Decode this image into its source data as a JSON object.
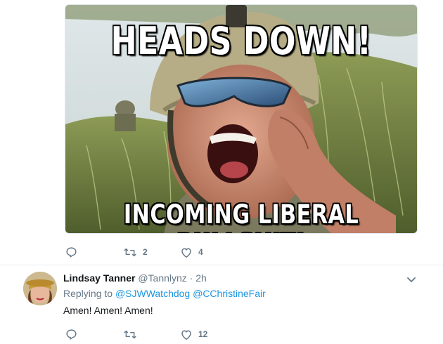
{
  "meme": {
    "top_text": "HEADS DOWN!",
    "bottom_text": "INCOMING LIBERAL BULLSHIT!"
  },
  "first_tweet_actions": {
    "reply_count": "",
    "retweet_count": "2",
    "like_count": "4"
  },
  "reply": {
    "display_name": "Lindsay Tanner",
    "handle": "@Tannlynz",
    "separator": "·",
    "time": "2h",
    "replying_prefix": "Replying to",
    "mentions": [
      "@SJWWatchdog",
      "@CChristineFair"
    ],
    "text": "Amen! Amen! Amen!",
    "actions": {
      "reply_count": "",
      "retweet_count": "",
      "like_count": "12"
    }
  },
  "icons": {
    "reply": "reply-icon",
    "retweet": "retweet-icon",
    "like": "heart-icon",
    "more": "chevron-down-icon"
  },
  "colors": {
    "muted": "#657786",
    "link": "#1b95e0",
    "text": "#14171a",
    "divider": "#e6ecf0"
  }
}
